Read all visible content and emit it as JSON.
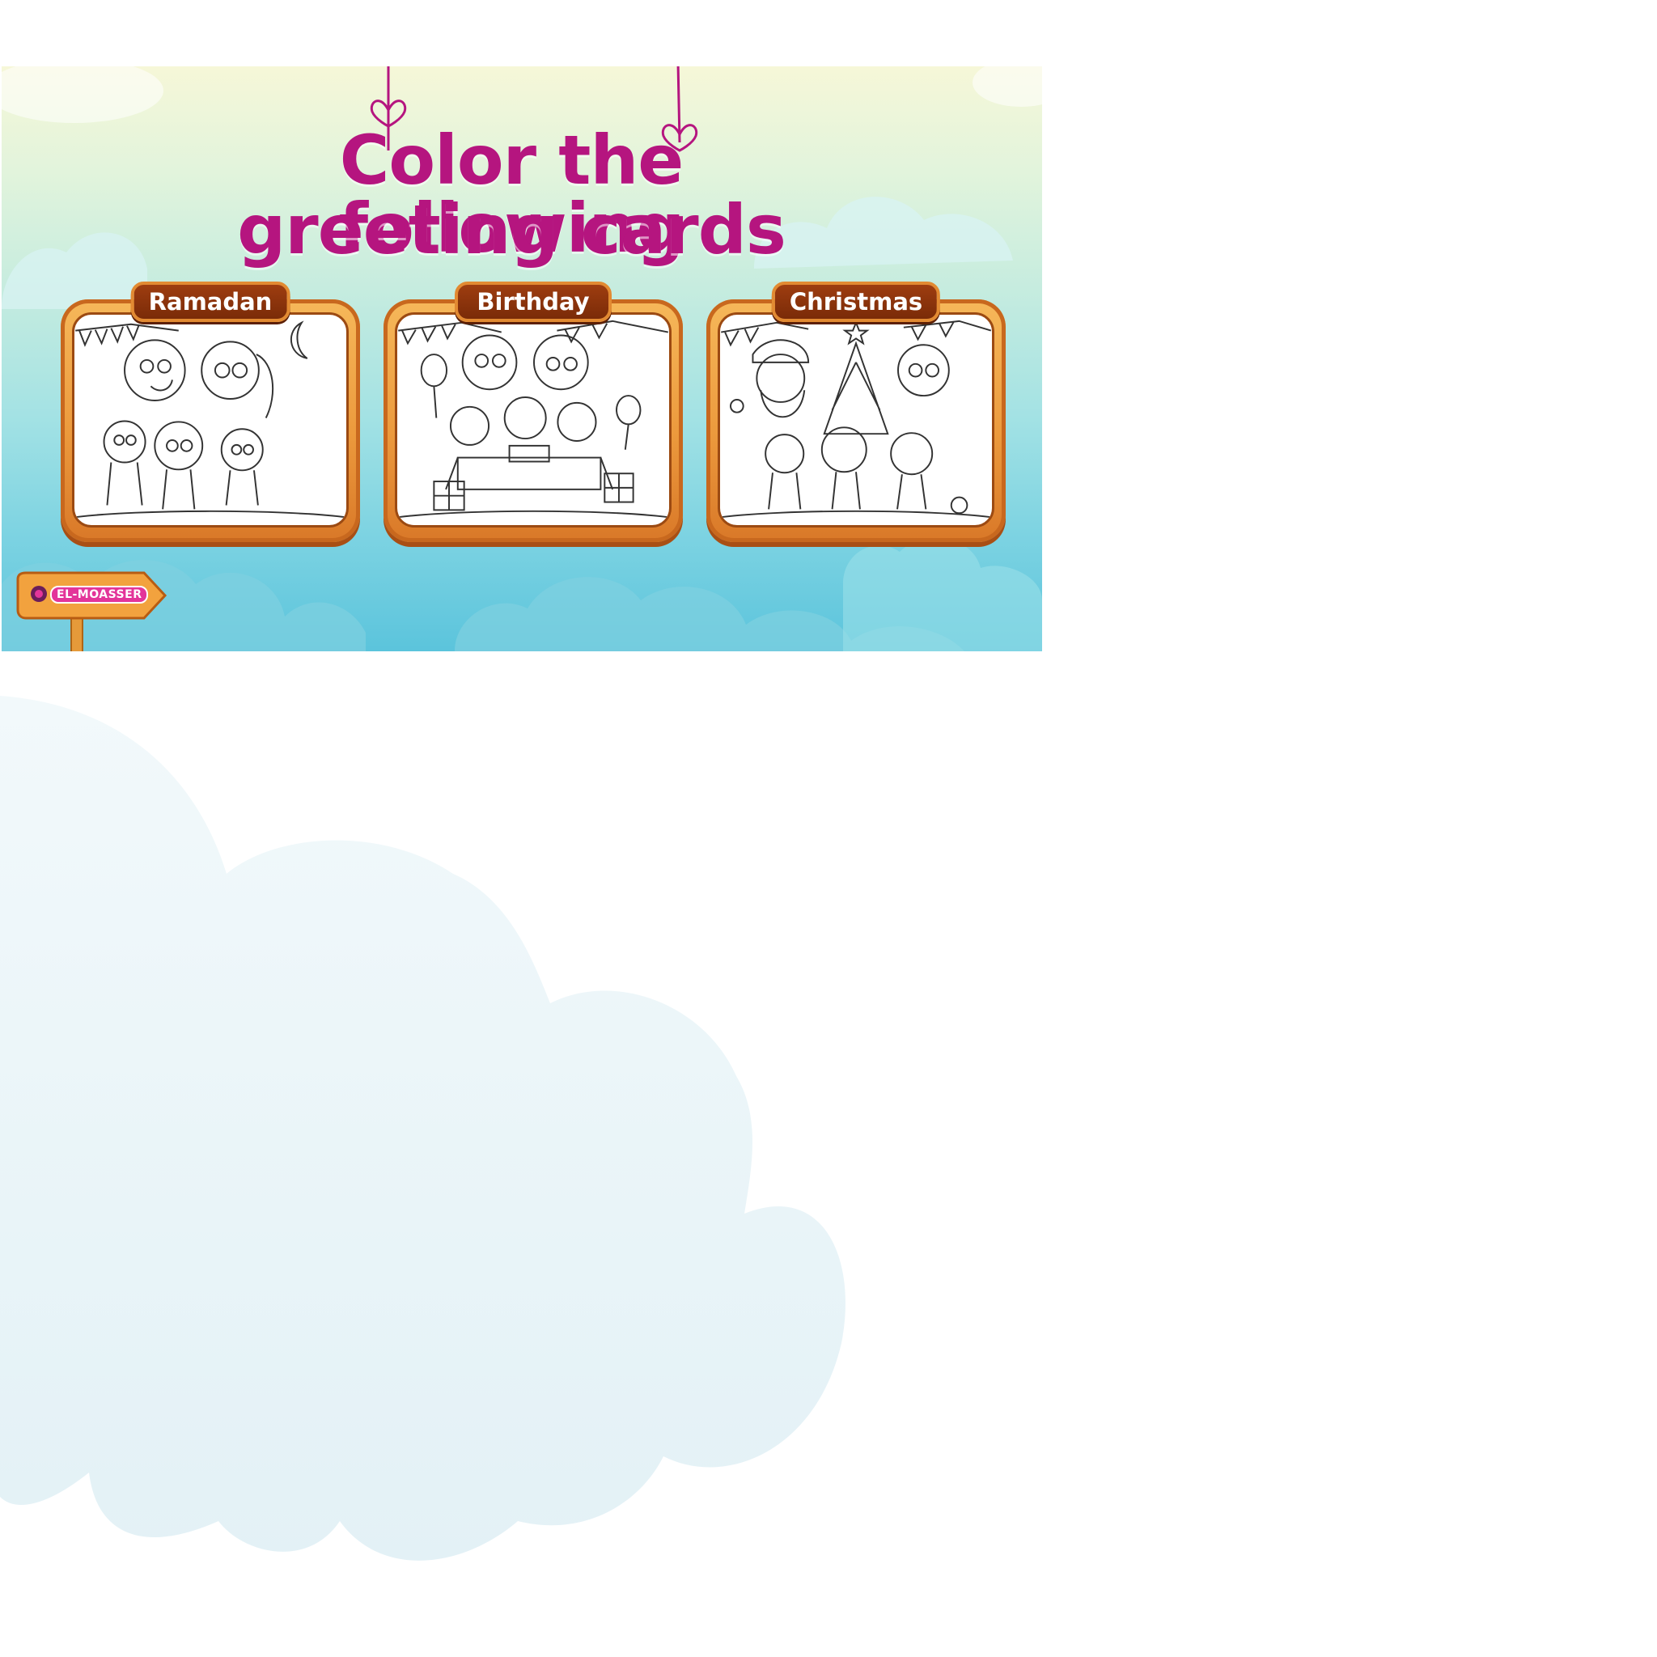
{
  "page": {
    "title_line1": "Color the following",
    "title_line2": "greeting cards",
    "title_color": "#b5157f"
  },
  "cards": [
    {
      "label": "Ramadan",
      "theme": "family with crescent moon and bunting"
    },
    {
      "label": "Birthday",
      "theme": "family around cake with balloons and gifts"
    },
    {
      "label": "Christmas",
      "theme": "family with Santa and Christmas tree"
    }
  ],
  "logo": {
    "text": "EL-MOASSER"
  },
  "colors": {
    "frame_orange": "#ec9a3d",
    "label_brown": "#7a2b08",
    "sky_blue": "#5bc4dc",
    "logo_pink": "#e3359a"
  },
  "icons": [
    "heart-hanger-icon",
    "crescent-moon-icon",
    "balloon-icon",
    "gift-icon",
    "christmas-tree-icon",
    "star-icon",
    "logo-eye-icon"
  ]
}
